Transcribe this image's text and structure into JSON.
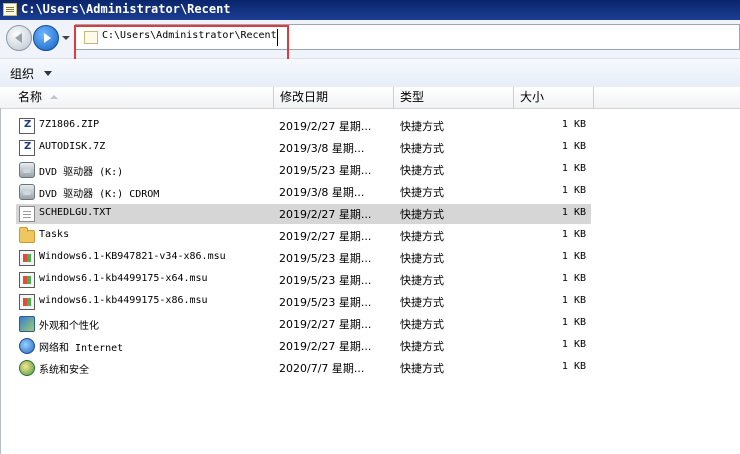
{
  "window": {
    "title": "C:\\Users\\Administrator\\Recent"
  },
  "address_bar": {
    "path": "C:\\Users\\Administrator\\Recent"
  },
  "commands": {
    "organize_label": "组织"
  },
  "columns": {
    "name": "名称",
    "date": "修改日期",
    "type": "类型",
    "size": "大小"
  },
  "files": [
    {
      "name": "7Z1806.ZIP",
      "date": "2019/2/27 星期...",
      "type": "快捷方式",
      "size": "1 KB",
      "icon": "zip-shortcut-icon"
    },
    {
      "name": "AUTODISK.7Z",
      "date": "2019/3/8 星期...",
      "type": "快捷方式",
      "size": "1 KB",
      "icon": "zip-shortcut-icon"
    },
    {
      "name": "DVD 驱动器 (K:)",
      "date": "2019/5/23 星期...",
      "type": "快捷方式",
      "size": "1 KB",
      "icon": "dvd-drive-icon"
    },
    {
      "name": "DVD 驱动器 (K:) CDROM",
      "date": "2019/3/8 星期...",
      "type": "快捷方式",
      "size": "1 KB",
      "icon": "dvd-drive-icon"
    },
    {
      "name": "SCHEDLGU.TXT",
      "date": "2019/2/27 星期...",
      "type": "快捷方式",
      "size": "1 KB",
      "icon": "text-file-icon",
      "selected": true
    },
    {
      "name": "Tasks",
      "date": "2019/2/27 星期...",
      "type": "快捷方式",
      "size": "1 KB",
      "icon": "folder-icon"
    },
    {
      "name": "Windows6.1-KB947821-v34-x86.msu",
      "date": "2019/5/23 星期...",
      "type": "快捷方式",
      "size": "1 KB",
      "icon": "msu-package-icon"
    },
    {
      "name": "windows6.1-kb4499175-x64.msu",
      "date": "2019/5/23 星期...",
      "type": "快捷方式",
      "size": "1 KB",
      "icon": "msu-package-icon"
    },
    {
      "name": "windows6.1-kb4499175-x86.msu",
      "date": "2019/5/23 星期...",
      "type": "快捷方式",
      "size": "1 KB",
      "icon": "msu-package-icon"
    },
    {
      "name": "外观和个性化",
      "date": "2019/2/27 星期...",
      "type": "快捷方式",
      "size": "1 KB",
      "icon": "control-panel-icon"
    },
    {
      "name": "网络和 Internet",
      "date": "2019/2/27 星期...",
      "type": "快捷方式",
      "size": "1 KB",
      "icon": "network-icon"
    },
    {
      "name": "系统和安全",
      "date": "2020/7/7 星期...",
      "type": "快捷方式",
      "size": "1 KB",
      "icon": "security-icon"
    }
  ],
  "colors": {
    "title_bar": "#0a246a",
    "highlight_border": "#e03a3a",
    "selected_row": "#d6d6d6"
  }
}
